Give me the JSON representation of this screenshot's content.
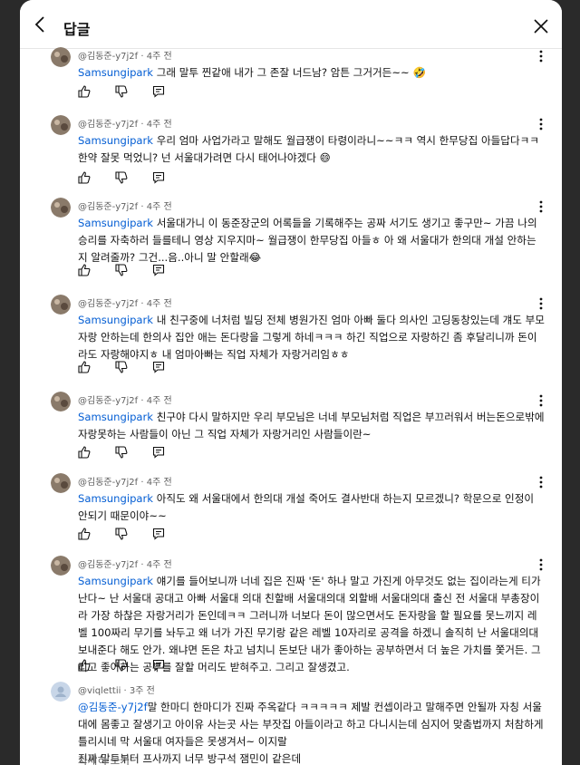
{
  "header": {
    "title": "답글"
  },
  "comments": [
    {
      "author": "@김동준-y7j2f",
      "time": "4주 전",
      "mention": "Samsungipark",
      "text": " 그래 말투 찐같애 내가 그 존잘 너드남? 암튼 그거거든~~",
      "emoji": "🤣"
    },
    {
      "author": "@김동준-y7j2f",
      "time": "4주 전",
      "mention": "Samsungipark",
      "text": " 우리 엄마 사업가라고 말해도 월급쟁이 타령이라니~~ㅋㅋ 역시 한무당집 아들답다ㅋㅋ 한약 잘못 먹었니? 넌 서울대가려면 다시 태어나야겠다",
      "emoji": "😄"
    },
    {
      "author": "@김동준-y7j2f",
      "time": "4주 전",
      "mention": "Samsungipark",
      "text": " 서울대가니 이 동준장군의 어록들을 기록해주는 공짜 서기도 생기고 좋구만~ 가끔 나의 승리를 자축하러 들를테니 영상 지우지마~ 월급쟁이 한무당집 아들ㅎ 아 왜 서울대가 한의대 개설 안하는지 알려줄까? 그건...음..아니 말 안할래",
      "emoji": "😂"
    },
    {
      "author": "@김동준-y7j2f",
      "time": "4주 전",
      "mention": "Samsungipark",
      "text": " 내 친구중에 너처럼 빌딩 전체 병원가진 엄마 아빠 둘다 의사인 고딩동창있는데 걔도 부모자랑 안하는데 한의사 집안 애는 돈다랑을 그렇게 하네ㅋㅋㅋ 하긴 직업으로 자랑하긴 좀 후달리니까 돈이라도 자랑해야지ㅎ 내 엄마아빠는 직업 자체가 자랑거리임ㅎㅎ",
      "emoji": ""
    },
    {
      "author": "@김동준-y7j2f",
      "time": "4주 전",
      "mention": "Samsungipark",
      "text": " 친구야 다시 말하지만 우리 부모님은 너네 부모님처럼 직업은 부끄러워서 버는돈으로밖에 자랑못하는 사람들이 아닌 그 직업 자체가 자랑거리인 사람들이란~",
      "emoji": ""
    },
    {
      "author": "@김동준-y7j2f",
      "time": "4주 전",
      "mention": "Samsungipark",
      "text": " 아직도 왜 서울대에서 한의대 개설 죽어도 결사반대 하는지 모르겠니? 학문으로 인정이 안되기 때문이야~~",
      "emoji": ""
    },
    {
      "author": "@김동준-y7j2f",
      "time": "4주 전",
      "mention": "Samsungipark",
      "text": " 얘기를 들어보니까 너네 집은 진짜 '돈' 하나 말고 가진게 아무것도 없는 집이라는게 티가난다~ 난 서울대 공대고 아빠 서울대 의대 친할배 서울대의대 외할배 서울대의대 출신 전 서울대 부총장이라 가장 하찮은 자랑거리가 돈인데ㅋㅋ 그러니까 너보다 돈이 많으면서도 돈자랑을 할 필요를 못느끼지 레벨 100짜리 무기를 놔두고 왜 너가 가진 무기랑 같은 레벨 10자리로 공격을 하겠니 솔직히 난 서울대의대 보내준다 해도 안가. 왜냐면 돈은 차고 넘치니 돈보단 내가 좋아하는 공부하면서 더 높은 가치를 쫓거든. 그리고 좋아하는 공부를 잘할 머리도 받혀주고. 그리고 잘생겼고.",
      "emoji": ""
    },
    {
      "author": "@viqlettii",
      "time": "3주 전",
      "mention": "@김동준-y7j2f",
      "text": "말 한마디 한마디가 진짜 주옥같다 ㅋㅋㅋㅋㅋ 제발 컨셉이라고 말해주면 안될까 자칭 서울대에 몸좋고 잘생기고 아이유 사는곳 사는 부잣집 아들이라고 하고 다니시는데 심지어 맞춤법까지 처참하게 틀리시네 막 서울대 여자들은 못생겨서~ 이지랄\n진짜 말투부터 프사까지 너무 방구석 잼민이 같은데",
      "emoji": "",
      "more": "자세히 보기"
    }
  ],
  "colors": {
    "mention": "#065fd4",
    "meta": "#606060",
    "text": "#0f0f0f"
  },
  "icons": [
    "back-arrow-icon",
    "close-icon",
    "more-vert-icon",
    "thumb-up-icon",
    "thumb-down-icon",
    "reply-icon"
  ]
}
